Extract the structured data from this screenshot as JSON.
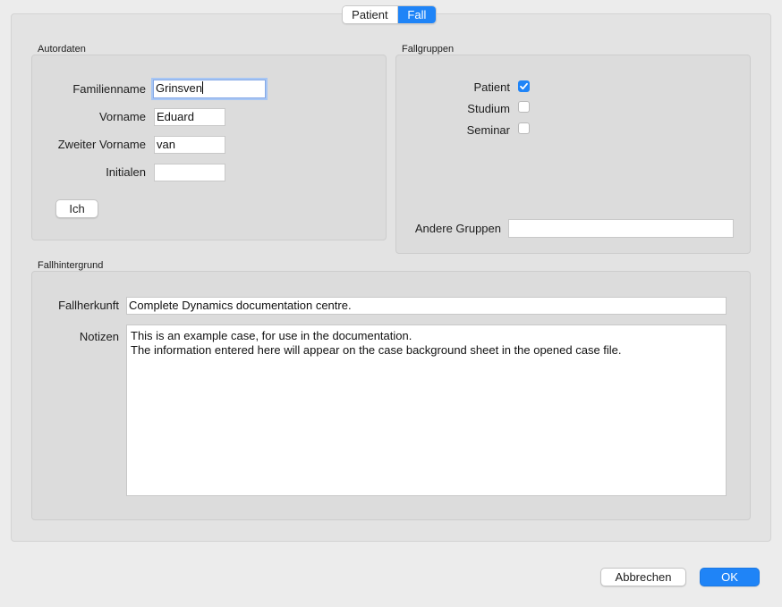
{
  "tabs": [
    {
      "label": "Patient",
      "selected": false
    },
    {
      "label": "Fall",
      "selected": true
    }
  ],
  "autordaten": {
    "title": "Autordaten",
    "fields": [
      {
        "label": "Familienname",
        "value": "Grinsven"
      },
      {
        "label": "Vorname",
        "value": "Eduard"
      },
      {
        "label": "Zweiter Vorname",
        "value": "van"
      },
      {
        "label": "Initialen",
        "value": ""
      }
    ],
    "ich_button": "Ich"
  },
  "fallgruppen": {
    "title": "Fallgruppen",
    "checkboxes": [
      {
        "label": "Patient",
        "checked": true
      },
      {
        "label": "Studium",
        "checked": false
      },
      {
        "label": "Seminar",
        "checked": false
      }
    ],
    "andere_label": "Andere Gruppen",
    "andere_value": ""
  },
  "fallhintergrund": {
    "title": "Fallhintergrund",
    "herkunft_label": "Fallherkunft",
    "herkunft_value": "Complete Dynamics documentation centre.",
    "notizen_label": "Notizen",
    "notizen_value": "This is an example case, for use in the documentation.\nThe information entered here will appear on the case background sheet in the opened case file."
  },
  "buttons": {
    "cancel": "Abbrechen",
    "ok": "OK"
  },
  "colors": {
    "accent": "#1f84f7",
    "window_bg": "#ececec",
    "group_bg": "#dcdcdc"
  }
}
